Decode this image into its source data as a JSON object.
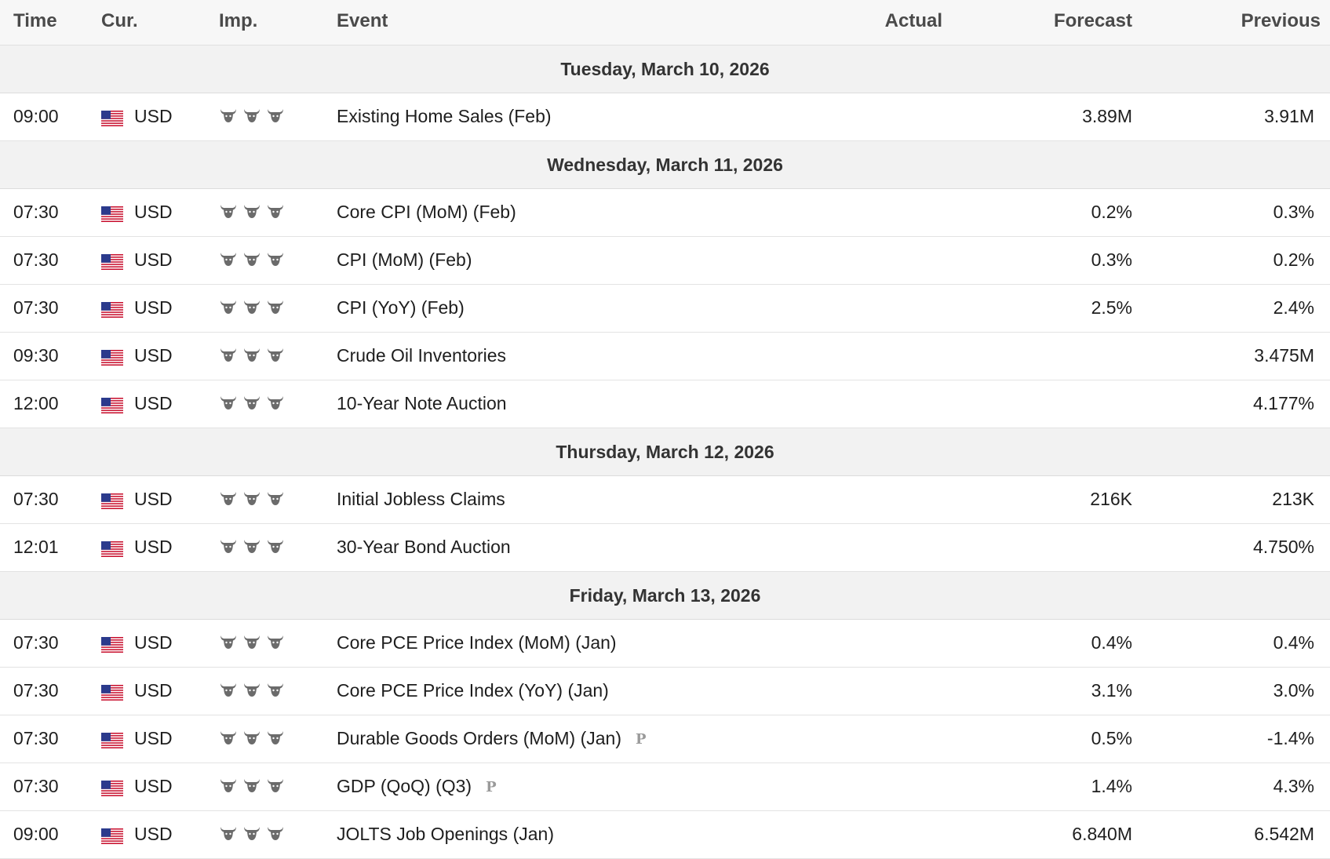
{
  "columns": {
    "time": "Time",
    "currency": "Cur.",
    "importance": "Imp.",
    "event": "Event",
    "actual": "Actual",
    "forecast": "Forecast",
    "previous": "Previous"
  },
  "colors": {
    "header_bg": "#f7f7f7",
    "day_bg": "#f2f2f2",
    "bull_icon": "#6b6b6b",
    "flag_red": "#c8102e",
    "flag_blue": "#2b3a8c"
  },
  "days": [
    {
      "label": "Tuesday, March 10, 2026",
      "events": [
        {
          "time": "09:00",
          "currency": "USD",
          "flag": "us-flag-icon",
          "importance": 3,
          "event": "Existing Home Sales (Feb)",
          "prelim": "",
          "actual": "",
          "forecast": "3.89M",
          "previous": "3.91M"
        }
      ]
    },
    {
      "label": "Wednesday, March 11, 2026",
      "events": [
        {
          "time": "07:30",
          "currency": "USD",
          "flag": "us-flag-icon",
          "importance": 3,
          "event": "Core CPI (MoM) (Feb)",
          "prelim": "",
          "actual": "",
          "forecast": "0.2%",
          "previous": "0.3%"
        },
        {
          "time": "07:30",
          "currency": "USD",
          "flag": "us-flag-icon",
          "importance": 3,
          "event": "CPI (MoM) (Feb)",
          "prelim": "",
          "actual": "",
          "forecast": "0.3%",
          "previous": "0.2%"
        },
        {
          "time": "07:30",
          "currency": "USD",
          "flag": "us-flag-icon",
          "importance": 3,
          "event": "CPI (YoY) (Feb)",
          "prelim": "",
          "actual": "",
          "forecast": "2.5%",
          "previous": "2.4%"
        },
        {
          "time": "09:30",
          "currency": "USD",
          "flag": "us-flag-icon",
          "importance": 3,
          "event": "Crude Oil Inventories",
          "prelim": "",
          "actual": "",
          "forecast": "",
          "previous": "3.475M"
        },
        {
          "time": "12:00",
          "currency": "USD",
          "flag": "us-flag-icon",
          "importance": 3,
          "event": "10-Year Note Auction",
          "prelim": "",
          "actual": "",
          "forecast": "",
          "previous": "4.177%"
        }
      ]
    },
    {
      "label": "Thursday, March 12, 2026",
      "events": [
        {
          "time": "07:30",
          "currency": "USD",
          "flag": "us-flag-icon",
          "importance": 3,
          "event": "Initial Jobless Claims",
          "prelim": "",
          "actual": "",
          "forecast": "216K",
          "previous": "213K"
        },
        {
          "time": "12:01",
          "currency": "USD",
          "flag": "us-flag-icon",
          "importance": 3,
          "event": "30-Year Bond Auction",
          "prelim": "",
          "actual": "",
          "forecast": "",
          "previous": "4.750%"
        }
      ]
    },
    {
      "label": "Friday, March 13, 2026",
      "events": [
        {
          "time": "07:30",
          "currency": "USD",
          "flag": "us-flag-icon",
          "importance": 3,
          "event": "Core PCE Price Index (MoM) (Jan)",
          "prelim": "",
          "actual": "",
          "forecast": "0.4%",
          "previous": "0.4%"
        },
        {
          "time": "07:30",
          "currency": "USD",
          "flag": "us-flag-icon",
          "importance": 3,
          "event": "Core PCE Price Index (YoY) (Jan)",
          "prelim": "",
          "actual": "",
          "forecast": "3.1%",
          "previous": "3.0%"
        },
        {
          "time": "07:30",
          "currency": "USD",
          "flag": "us-flag-icon",
          "importance": 3,
          "event": "Durable Goods Orders (MoM) (Jan)",
          "prelim": "P",
          "actual": "",
          "forecast": "0.5%",
          "previous": "-1.4%"
        },
        {
          "time": "07:30",
          "currency": "USD",
          "flag": "us-flag-icon",
          "importance": 3,
          "event": "GDP (QoQ) (Q3)",
          "prelim": "P",
          "actual": "",
          "forecast": "1.4%",
          "previous": "4.3%"
        },
        {
          "time": "09:00",
          "currency": "USD",
          "flag": "us-flag-icon",
          "importance": 3,
          "event": "JOLTS Job Openings (Jan)",
          "prelim": "",
          "actual": "",
          "forecast": "6.840M",
          "previous": "6.542M"
        }
      ]
    }
  ]
}
